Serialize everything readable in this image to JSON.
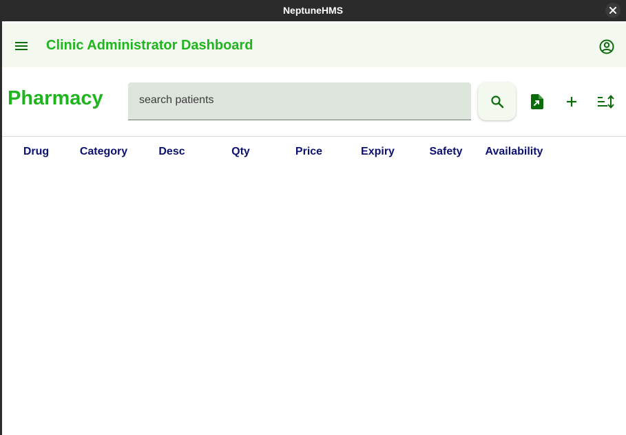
{
  "window": {
    "title": "NeptuneHMS",
    "close_icon": "close-icon"
  },
  "appbar": {
    "title": "Clinic Administrator Dashboard",
    "menu_icon": "menu-icon",
    "account_icon": "account-circle-icon"
  },
  "page": {
    "title": "Pharmacy"
  },
  "search": {
    "placeholder": "search patients",
    "value": "",
    "button_icon": "search-icon"
  },
  "toolbar": {
    "icons": [
      "export-file-icon",
      "add-icon",
      "sort-icon"
    ]
  },
  "table": {
    "columns": [
      "Drug",
      "Category",
      "Desc",
      "Qty",
      "Price",
      "Expiry",
      "Safety",
      "Availability"
    ],
    "rows": []
  },
  "colors": {
    "accent": "#1fb51f",
    "header_text": "#0b1170",
    "icon": "#0a6b0a",
    "appbar_bg": "#f4f9ef",
    "search_bg": "#dee5dc"
  }
}
